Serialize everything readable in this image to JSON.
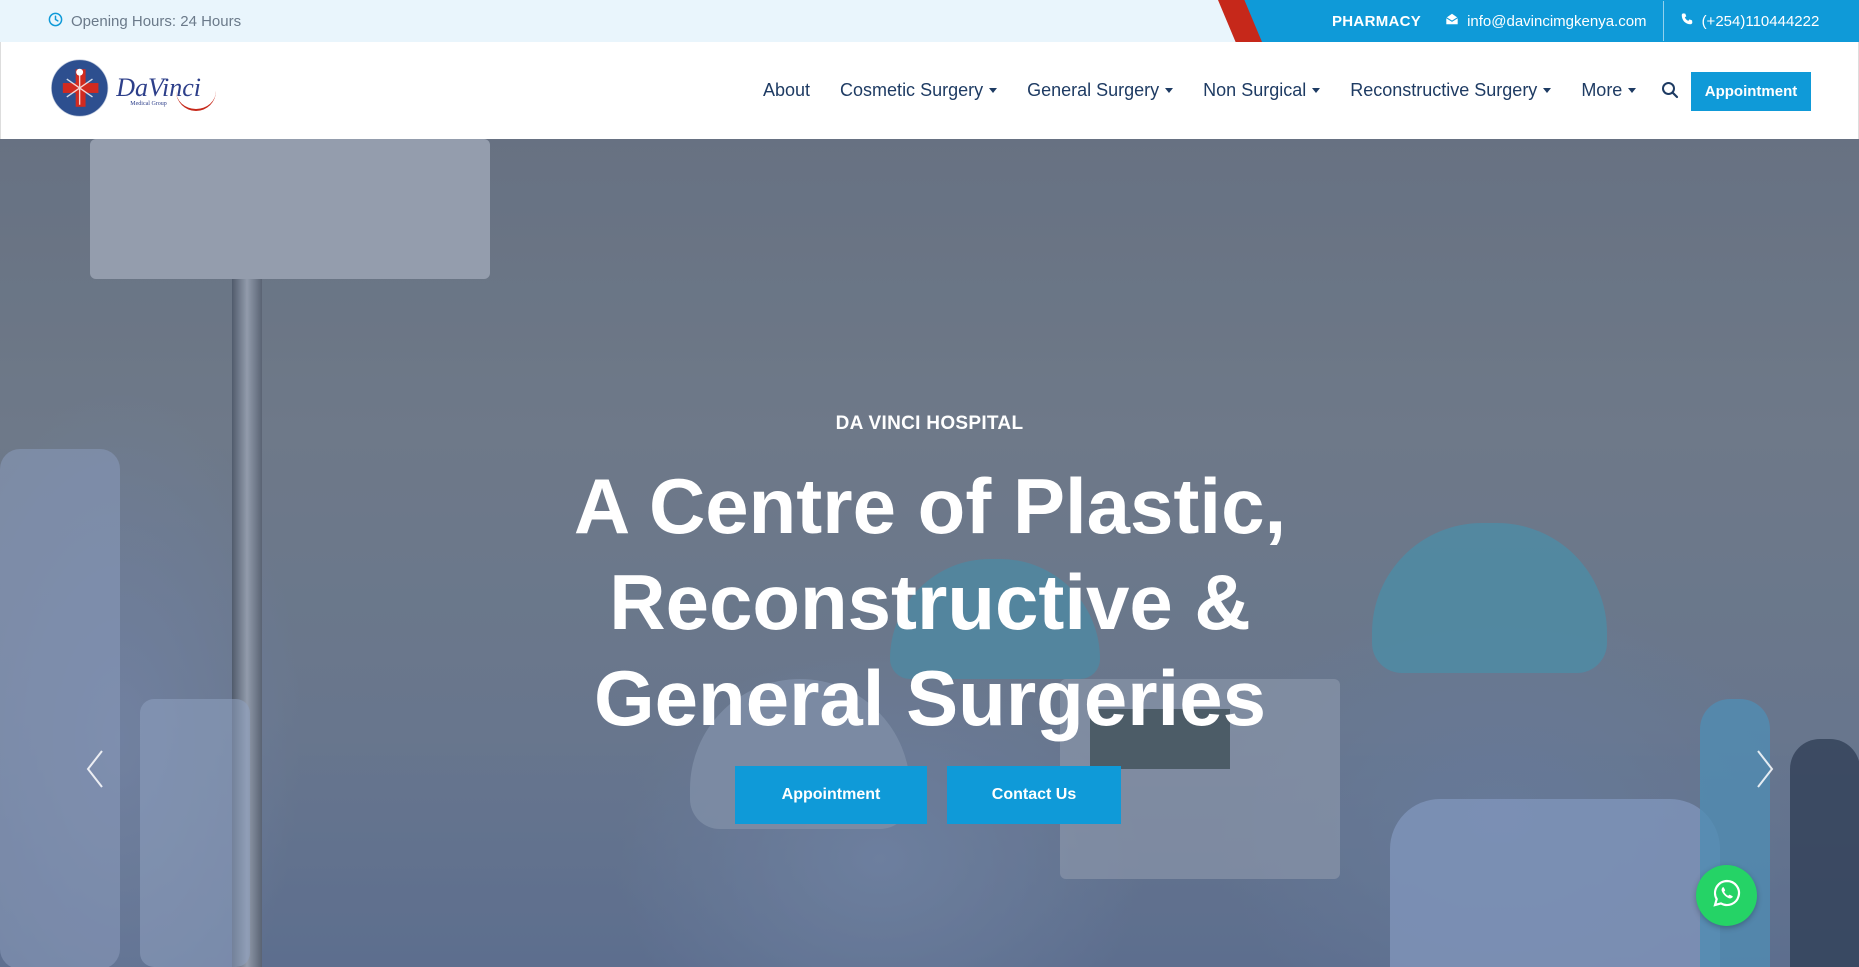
{
  "topbar": {
    "hours_text": "Opening Hours: 24 Hours",
    "pharmacy_label": "PHARMACY",
    "email": "info@davincimgkenya.com",
    "phone": "(+254)110444222"
  },
  "brand": {
    "logo_text": "DaVinci",
    "logo_subtext": "Medical Group"
  },
  "nav": {
    "items": [
      {
        "label": "About",
        "dropdown": false
      },
      {
        "label": "Cosmetic Surgery",
        "dropdown": true
      },
      {
        "label": "General Surgery",
        "dropdown": true
      },
      {
        "label": "Non Surgical",
        "dropdown": true
      },
      {
        "label": "Reconstructive Surgery",
        "dropdown": true
      },
      {
        "label": "More",
        "dropdown": true
      }
    ],
    "appointment_label": "Appointment"
  },
  "hero": {
    "subtitle": "DA VINCI HOSPITAL",
    "title": "A Centre of Plastic, Reconstructive & General Surgeries",
    "appointment_label": "Appointment",
    "contact_label": "Contact Us"
  },
  "colors": {
    "accent": "#0f9ad8",
    "brand_red": "#c6281a",
    "nav_text": "#1e3b63",
    "topbar_bg": "#e9f5fc",
    "whatsapp": "#25d366"
  },
  "icons": {
    "clock": "clock-icon",
    "email": "envelope-open-icon",
    "phone": "phone-icon",
    "search": "search-icon",
    "prev": "chevron-left-icon",
    "next": "chevron-right-icon",
    "whatsapp": "whatsapp-icon"
  }
}
